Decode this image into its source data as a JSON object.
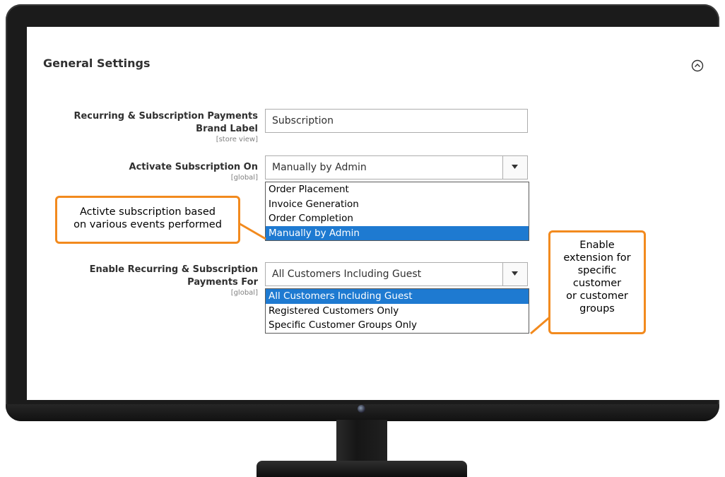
{
  "section": {
    "title": "General Settings"
  },
  "fields": {
    "brand_label": {
      "label_line1": "Recurring & Subscription Payments",
      "label_line2": "Brand Label",
      "scope": "[store view]",
      "value": "Subscription"
    },
    "activate_on": {
      "label": "Activate Subscription On",
      "scope": "[global]",
      "value": "Manually by Admin",
      "options": [
        "Order Placement",
        "Invoice Generation",
        "Order Completion",
        "Manually by Admin"
      ]
    },
    "enable_for": {
      "label_line1": "Enable Recurring & Subscription",
      "label_line2": "Payments For",
      "scope": "[global]",
      "value": "All Customers Including Guest",
      "options": [
        "All Customers Including Guest",
        "Registered Customers Only",
        "Specific Customer Groups Only"
      ]
    }
  },
  "callouts": {
    "activate": {
      "line1": "Activte subscription based",
      "line2": "on various events performed"
    },
    "enable": {
      "line1": "Enable",
      "line2": "extension for",
      "line3": "specific",
      "line4": "customer",
      "line5": "or customer",
      "line6": "groups"
    }
  },
  "colors": {
    "selected_option_bg": "#1e7ad1",
    "callout_border": "#f28a1e",
    "monitor_bezel": "#1b1b1b"
  }
}
